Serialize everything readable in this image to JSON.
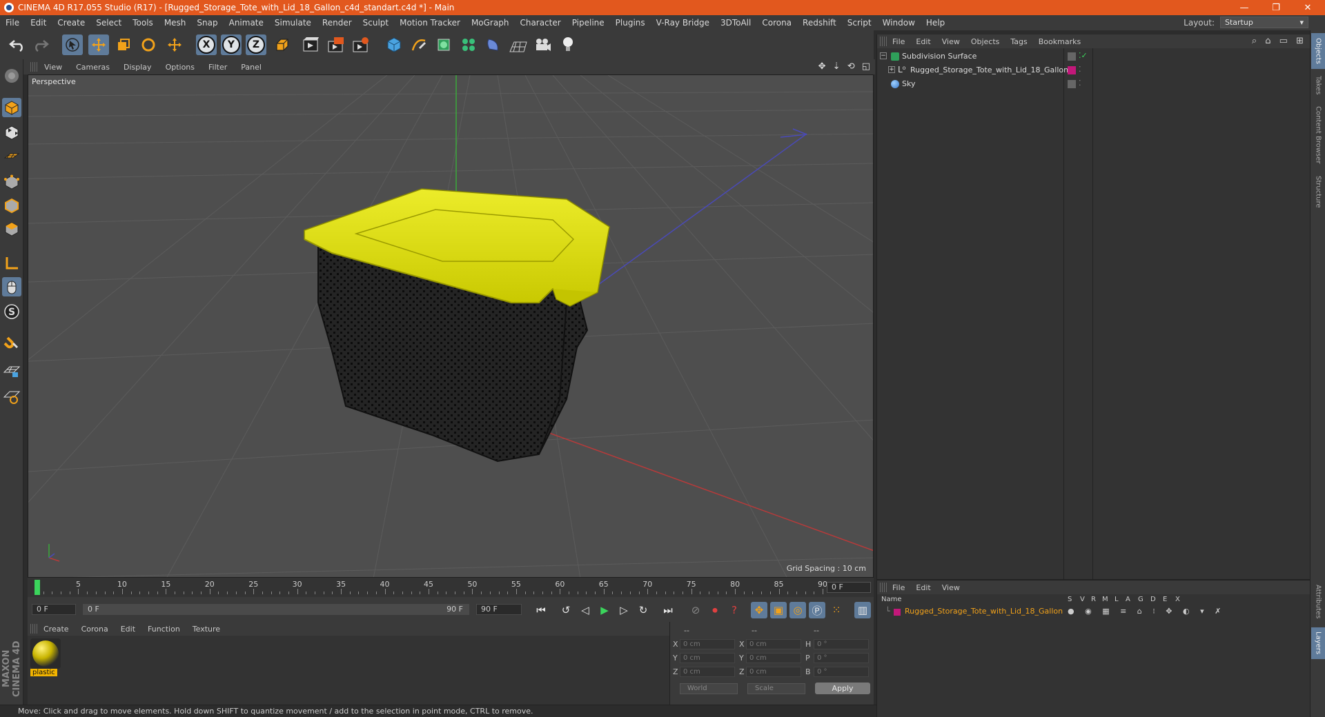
{
  "window": {
    "title": "CINEMA 4D R17.055 Studio (R17) - [Rugged_Storage_Tote_with_Lid_18_Gallon_c4d_standart.c4d *] - Main",
    "minimize": "—",
    "maximize": "❐",
    "close": "✕"
  },
  "menubar": {
    "items": [
      "File",
      "Edit",
      "Create",
      "Select",
      "Tools",
      "Mesh",
      "Snap",
      "Animate",
      "Simulate",
      "Render",
      "Sculpt",
      "Motion Tracker",
      "MoGraph",
      "Character",
      "Pipeline",
      "Plugins",
      "V-Ray Bridge",
      "3DToAll",
      "Corona",
      "Redshift",
      "Script",
      "Window",
      "Help"
    ],
    "layout_label": "Layout:",
    "layout_value": "Startup"
  },
  "toolbar": {
    "axis_x": "X",
    "axis_y": "Y",
    "axis_z": "Z",
    "icons": [
      "undo-icon",
      "redo-icon",
      "select-arrow-icon",
      "move-icon",
      "scale-icon",
      "rotate-icon",
      "live-select-icon",
      "x-axis-icon",
      "y-axis-icon",
      "z-axis-icon",
      "coordinate-system-icon",
      "render-view-icon",
      "render-picture-viewer-icon",
      "render-settings-icon",
      "cube-primitive-icon",
      "pen-spline-icon",
      "subdivision-surface-icon",
      "cloner-icon",
      "deformer-icon",
      "floor-icon",
      "camera-icon",
      "light-icon"
    ]
  },
  "viewport": {
    "menu": [
      "View",
      "Cameras",
      "Display",
      "Options",
      "Filter",
      "Panel"
    ],
    "label": "Perspective",
    "grid_spacing": "Grid Spacing : 10 cm",
    "colors": {
      "background": "#4e4e4e",
      "grid": "#5c5c5c",
      "x_axis": "#b83a3a",
      "y_axis": "#3aa83a",
      "z_axis": "#4a4ab8",
      "lid": "#e0e000",
      "tote": "#1c1c1c"
    }
  },
  "timeline": {
    "ticks": [
      "0",
      "5",
      "10",
      "15",
      "20",
      "25",
      "30",
      "35",
      "40",
      "45",
      "50",
      "55",
      "60",
      "65",
      "70",
      "75",
      "80",
      "85",
      "90"
    ],
    "end_frame": "0 F",
    "start_field": "0 F",
    "range_start": "0 F",
    "range_end": "90 F",
    "max_field": "90 F"
  },
  "materials": {
    "menu": [
      "Create",
      "Corona",
      "Edit",
      "Function",
      "Texture"
    ],
    "items": [
      {
        "name": "plastic"
      }
    ]
  },
  "coords": {
    "headers": [
      "--",
      "--",
      "--"
    ],
    "rows": [
      {
        "a": "X",
        "av": "0 cm",
        "b": "X",
        "bv": "0 cm",
        "c": "H",
        "cv": "0 °"
      },
      {
        "a": "Y",
        "av": "0 cm",
        "b": "Y",
        "bv": "0 cm",
        "c": "P",
        "cv": "0 °"
      },
      {
        "a": "Z",
        "av": "0 cm",
        "b": "Z",
        "bv": "0 cm",
        "c": "B",
        "cv": "0 °"
      }
    ],
    "space": "World",
    "mode": "Scale",
    "apply": "Apply"
  },
  "status": {
    "text": "Move: Click and drag to move elements. Hold down SHIFT to quantize movement / add to the selection in point mode, CTRL to remove."
  },
  "branding": {
    "logo": "MAXON CINEMA 4D"
  },
  "objects": {
    "menu": [
      "File",
      "Edit",
      "View",
      "Objects",
      "Tags",
      "Bookmarks"
    ],
    "items": [
      {
        "name": "Subdivision Surface",
        "icon": "subdivision-icon"
      },
      {
        "name": "Rugged_Storage_Tote_with_Lid_18_Gallon",
        "icon": "null-object-icon"
      },
      {
        "name": "Sky",
        "icon": "sky-icon"
      }
    ]
  },
  "layers": {
    "menu": [
      "File",
      "Edit",
      "View"
    ],
    "columns": [
      "Name",
      "S",
      "V",
      "R",
      "M",
      "L",
      "A",
      "G",
      "D",
      "E",
      "X"
    ],
    "items": [
      {
        "name": "Rugged_Storage_Tote_with_Lid_18_Gallon",
        "color": "#c2187a"
      }
    ]
  },
  "side_tabs": [
    "Objects",
    "Takes",
    "Content Browser",
    "Structure",
    "Attributes",
    "Layers"
  ]
}
